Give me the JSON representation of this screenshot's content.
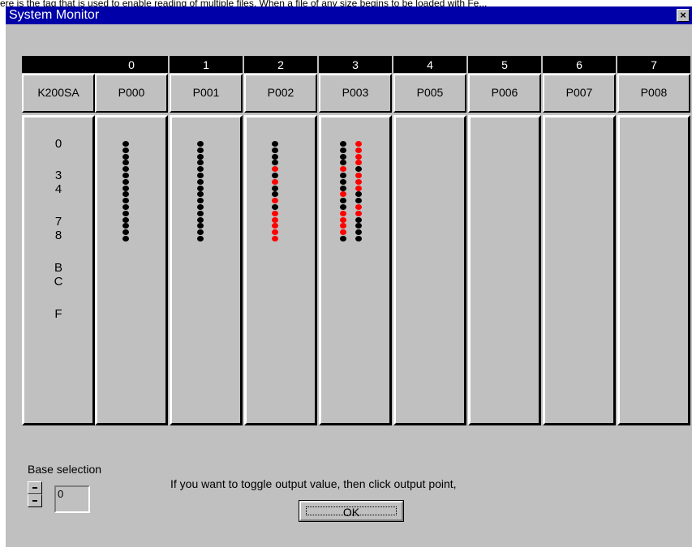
{
  "window": {
    "title": "System Monitor",
    "close_glyph": "×",
    "close_icon": "close-icon"
  },
  "background_partial_text": "ere is the tag that is used to enable reading of multiple files. When a file of any size begins to be loaded with Fe...",
  "slots": [
    {
      "number": "",
      "name": "K200SA"
    },
    {
      "number": "0",
      "name": "P000"
    },
    {
      "number": "1",
      "name": "P001"
    },
    {
      "number": "2",
      "name": "P002"
    },
    {
      "number": "3",
      "name": "P003"
    },
    {
      "number": "4",
      "name": "P005"
    },
    {
      "number": "5",
      "name": "P006"
    },
    {
      "number": "6",
      "name": "P007"
    },
    {
      "number": "7",
      "name": "P008"
    }
  ],
  "row_labels": [
    "0",
    "3",
    "4",
    "7",
    "8",
    "B",
    "C",
    "F"
  ],
  "io_modules": [
    {
      "slot": "P000",
      "columns": [
        [
          "off",
          "off",
          "off",
          "off",
          "off",
          "off",
          "off",
          "off",
          "off",
          "off",
          "off",
          "off",
          "off",
          "off",
          "off",
          "off"
        ]
      ]
    },
    {
      "slot": "P001",
      "columns": [
        [
          "off",
          "off",
          "off",
          "off",
          "off",
          "off",
          "off",
          "off",
          "off",
          "off",
          "off",
          "off",
          "off",
          "off",
          "off",
          "off"
        ]
      ]
    },
    {
      "slot": "P002",
      "columns": [
        [
          "off",
          "off",
          "off",
          "off",
          "on",
          "off",
          "on",
          "off",
          "off",
          "on",
          "off",
          "on",
          "on",
          "on",
          "on",
          "on"
        ]
      ]
    },
    {
      "slot": "P003",
      "columns": [
        [
          "off",
          "off",
          "off",
          "off",
          "on",
          "off",
          "off",
          "off",
          "on",
          "off",
          "off",
          "on",
          "on",
          "on",
          "on",
          "off"
        ],
        [
          "on",
          "on",
          "on",
          "on",
          "off",
          "on",
          "on",
          "on",
          "off",
          "off",
          "on",
          "on",
          "off",
          "off",
          "off",
          "off"
        ]
      ]
    }
  ],
  "led_colors": {
    "on": "#ff0000",
    "off": "#000000"
  },
  "base_selection": {
    "label": "Base selection",
    "value": "0"
  },
  "hint": "If you want to toggle output value, then click output point,",
  "ok_label": "OK"
}
